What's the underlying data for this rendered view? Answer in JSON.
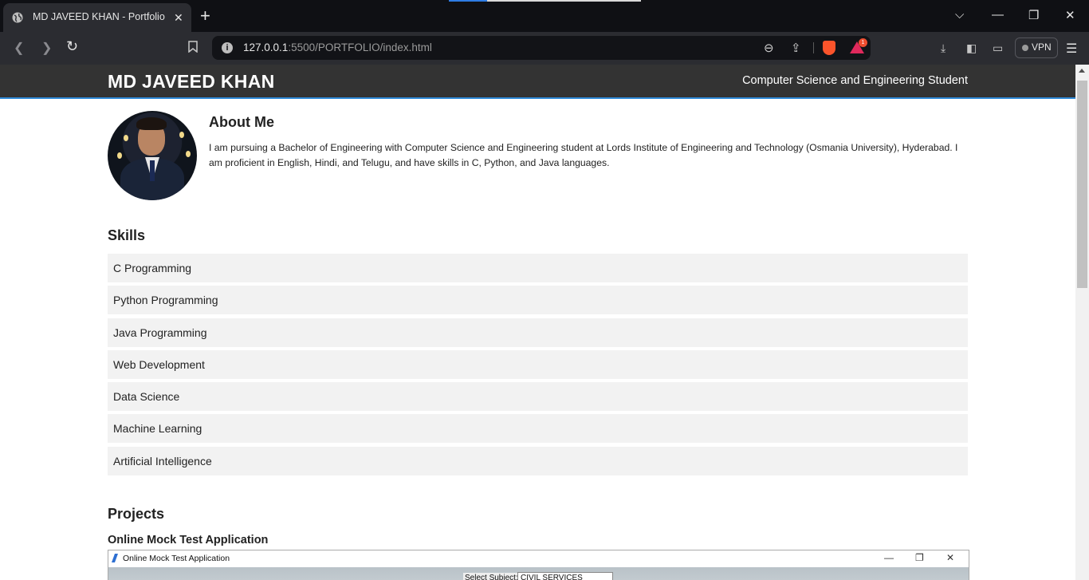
{
  "browser": {
    "tab_title": "MD JAVEED KHAN - Portfolio",
    "url_host": "127.0.0.1",
    "url_rest": ":5500/PORTFOLIO/index.html",
    "vpn_label": "VPN",
    "rewards_badge": "1"
  },
  "header": {
    "name": "MD JAVEED KHAN",
    "tagline": "Computer Science and Engineering Student"
  },
  "about": {
    "title": "About Me",
    "text": "I am pursuing a Bachelor of Engineering with Computer Science and Engineering student at Lords Institute of Engineering and Technology (Osmania University), Hyderabad. I am proficient in English, Hindi, and Telugu, and have skills in C, Python, and Java languages."
  },
  "skills": {
    "title": "Skills",
    "items": [
      "C Programming",
      "Python Programming",
      "Java Programming",
      "Web Development",
      "Data Science",
      "Machine Learning",
      "Artificial Intelligence"
    ]
  },
  "projects": {
    "title": "Projects",
    "items": [
      {
        "name": "Online Mock Test Application",
        "screenshot": {
          "window_title": "Online Mock Test Application",
          "select_label": "Select Subject:",
          "select_value": "CIVIL SERVICES"
        }
      }
    ]
  },
  "icons": {
    "tab_icon": "globe-icon",
    "brave": "brave-shield-icon",
    "rewards": "brave-rewards-icon"
  }
}
